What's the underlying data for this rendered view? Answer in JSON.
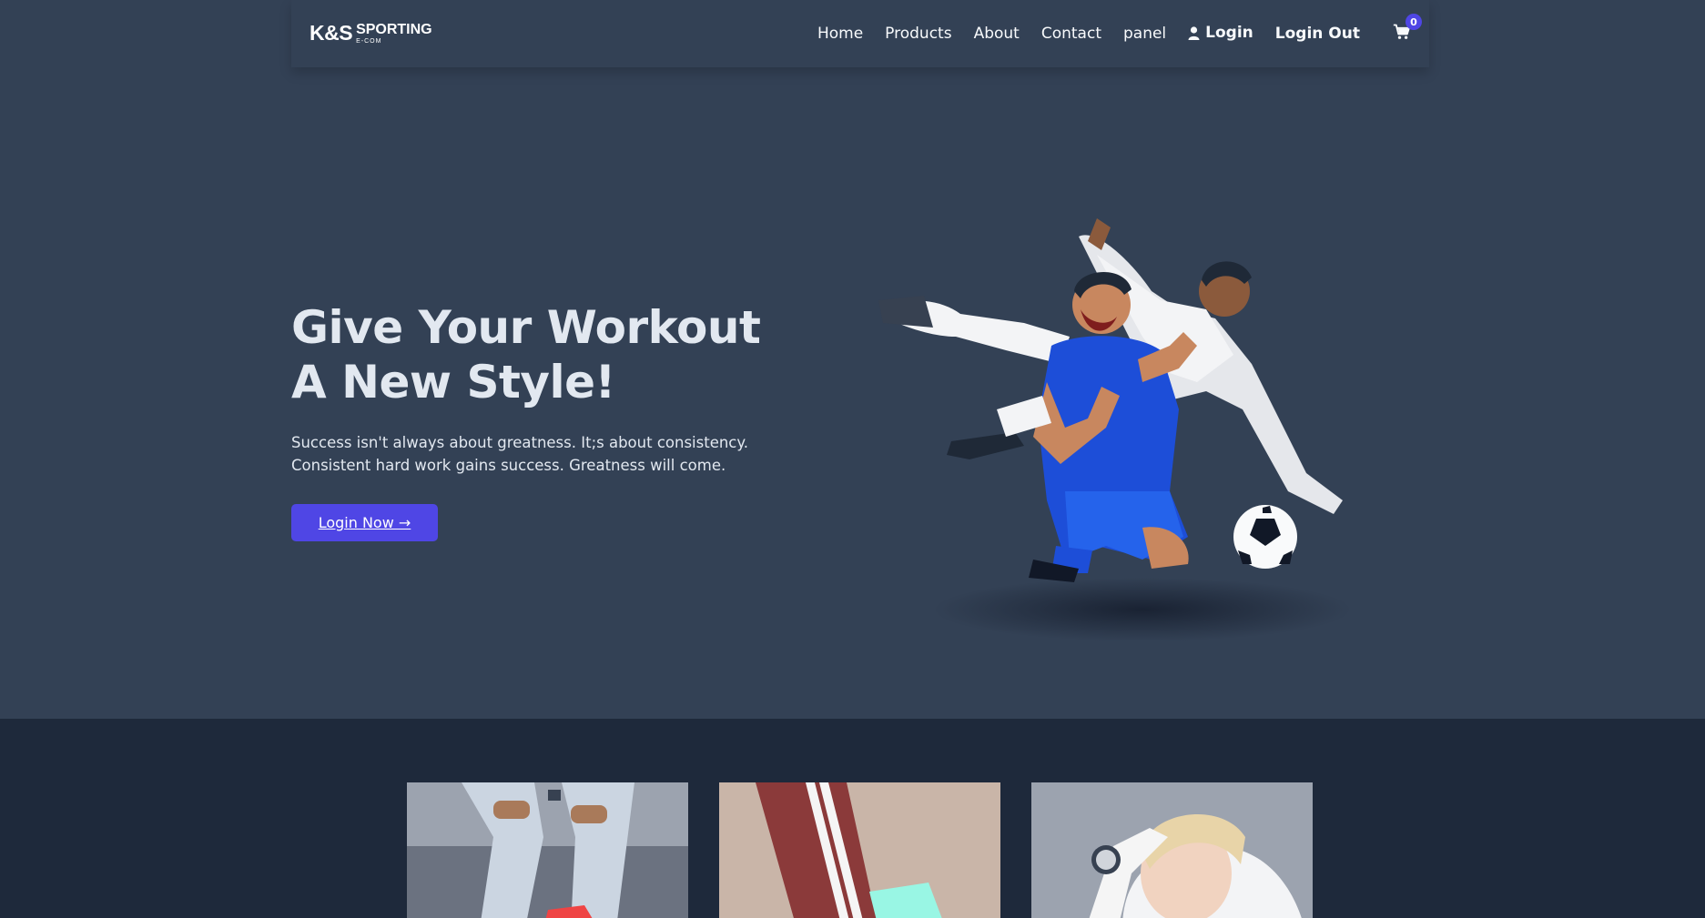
{
  "brand": {
    "logo_main": "K&S",
    "logo_top": "SPORTING",
    "logo_sub": "E-COM"
  },
  "nav": {
    "items": [
      {
        "label": "Home"
      },
      {
        "label": "Products"
      },
      {
        "label": "About"
      },
      {
        "label": "Contact"
      },
      {
        "label": "panel"
      }
    ],
    "login_label": "Login",
    "logout_label": "Login Out",
    "cart_icon": "shopping-cart-icon",
    "cart_count": "0"
  },
  "hero": {
    "title_line1": "Give Your Workout",
    "title_line2": "A New Style!",
    "description": "Success isn't always about greatness. It;s about consistency. Consistent hard work gains success. Greatness will come.",
    "button_label": "Login Now →",
    "image_icon": "soccer-players-image"
  },
  "products": {
    "cards": [
      {
        "image_icon": "jeans-sneakers-image"
      },
      {
        "image_icon": "track-pants-image"
      },
      {
        "image_icon": "woman-smartwatch-image"
      }
    ]
  },
  "colors": {
    "background": "#334155",
    "accent": "#4f46e5",
    "products_bg": "#1e293b"
  }
}
